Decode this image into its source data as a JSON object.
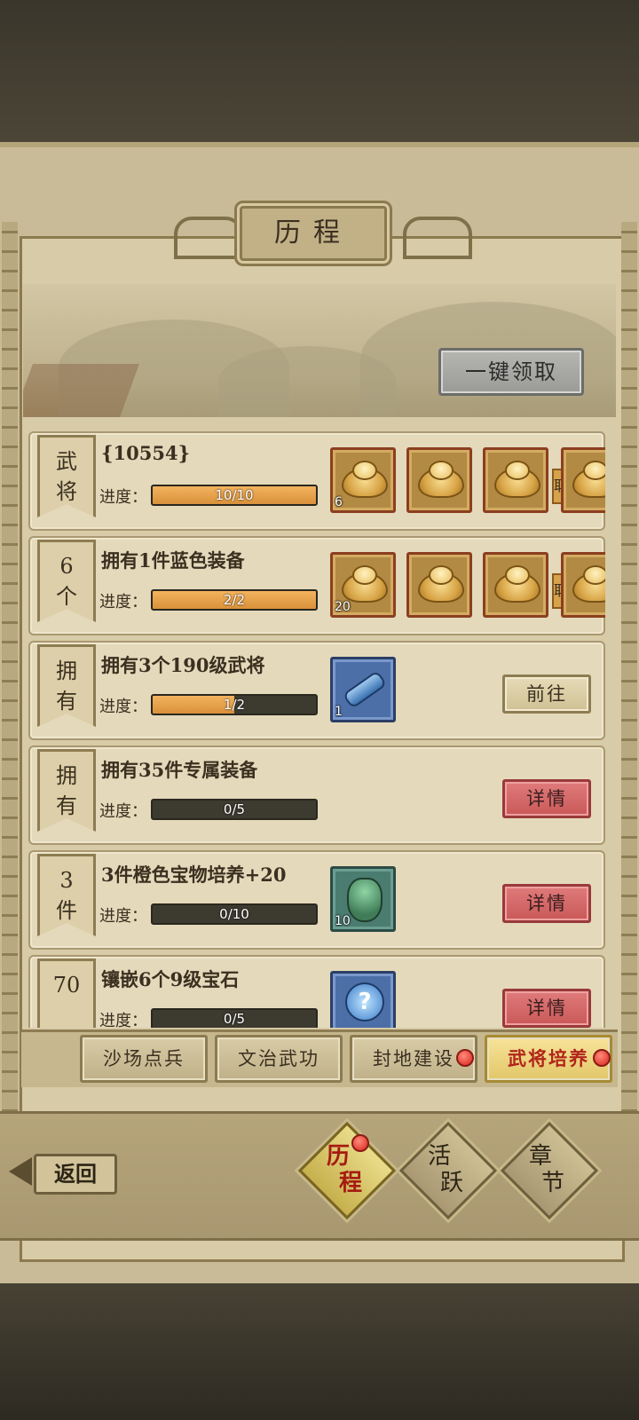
{
  "title": "历程",
  "claim_all_label": "一键领取",
  "progress_label": "进度：",
  "tasks": [
    {
      "tag": [
        "武",
        "将"
      ],
      "title": "{10554}",
      "progress": "10/10",
      "fraction": 1.0,
      "rewards": [
        {
          "icon": "ingot-icon",
          "qty": "6"
        },
        {
          "icon": "ingot-icon",
          "qty": ""
        },
        {
          "icon": "ingot-icon",
          "qty": ""
        },
        {
          "icon": "ingot-icon",
          "qty": ""
        }
      ],
      "claim_stub": "取"
    },
    {
      "tag": [
        "6",
        "个"
      ],
      "title": "拥有1件蓝色装备",
      "progress": "2/2",
      "fraction": 1.0,
      "rewards": [
        {
          "icon": "ingot-icon",
          "qty": "20"
        },
        {
          "icon": "ingot-icon",
          "qty": ""
        },
        {
          "icon": "ingot-icon",
          "qty": ""
        },
        {
          "icon": "ingot-icon",
          "qty": ""
        }
      ],
      "claim_stub": "取"
    },
    {
      "tag": [
        "拥",
        "有"
      ],
      "title": "拥有3个190级武将",
      "progress": "1/2",
      "fraction": 0.5,
      "rewards": [
        {
          "icon": "scroll-icon",
          "qty": "1"
        }
      ],
      "action": "前往"
    },
    {
      "tag": [
        "拥",
        "有"
      ],
      "title": "拥有35件专属装备",
      "progress": "0/5",
      "fraction": 0.0,
      "rewards": [],
      "action": "详情"
    },
    {
      "tag": [
        "3",
        "件"
      ],
      "title": "3件橙色宝物培养+20",
      "progress": "0/10",
      "fraction": 0.0,
      "rewards": [
        {
          "icon": "bag-icon",
          "qty": "10"
        }
      ],
      "action": "详情"
    },
    {
      "tag": [
        "70",
        ""
      ],
      "title": "镶嵌6个9级宝石",
      "progress": "0/5",
      "fraction": 0.0,
      "rewards": [
        {
          "icon": "mystery-icon",
          "qty": ""
        }
      ],
      "action": "详情"
    }
  ],
  "category_tabs": [
    "沙场点兵",
    "文治武功",
    "封地建设",
    "武将培养"
  ],
  "active_category": "武将培养",
  "back_label": "返回",
  "nav": [
    {
      "chars": [
        "历",
        "程"
      ],
      "active": true
    },
    {
      "chars": [
        "活",
        "跃"
      ],
      "active": false
    },
    {
      "chars": [
        "章",
        "节"
      ],
      "active": false
    }
  ],
  "colors": {
    "progress_fill": "#e2a049",
    "detail_button": "#d86a6a",
    "active_tab_text": "#b1241a",
    "notification_dot": "#d7261d"
  }
}
